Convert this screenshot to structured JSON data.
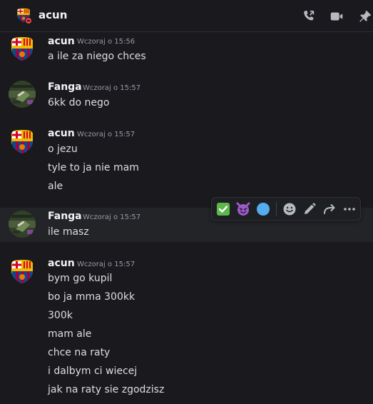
{
  "header": {
    "title": "acun",
    "icons": [
      "phone-call-icon",
      "video-camera-icon",
      "pin-icon"
    ]
  },
  "colors": {
    "background": "#1a1a1e",
    "hover_row": "#232428",
    "author": "#f2f3f5",
    "text": "#dbdee1",
    "timestamp": "#949ba4",
    "dnd_status": "#f23f43",
    "barca_blue": "#004d98",
    "barca_red": "#a50044",
    "barca_yellow": "#edbb00"
  },
  "messages": [
    {
      "author": "acun",
      "timestamp": "Wczoraj o 15:56",
      "lines": [
        "a ile za niego chces"
      ]
    },
    {
      "author": "Fanga",
      "timestamp": "Wczoraj o 15:57",
      "lines": [
        "6kk do nego"
      ]
    },
    {
      "author": "acun",
      "timestamp": "Wczoraj o 15:57",
      "lines": [
        "o jezu",
        "tyle to ja nie mam",
        "ale"
      ]
    },
    {
      "author": "Fanga",
      "timestamp": "Wczoraj o 15:57",
      "lines": [
        "ile masz"
      ]
    },
    {
      "author": "acun",
      "timestamp": "Wczoraj o 15:57",
      "lines": [
        "bym go kupil",
        "bo ja mma 300kk",
        "300k",
        "mam ale",
        "chce na raty",
        "i dalbym ci wiecej",
        "jak na raty sie zgodzisz"
      ]
    }
  ],
  "toolbar": {
    "actions": [
      "check-mark-reaction-icon",
      "smiling-imp-reaction-icon",
      "blue-circle-reaction-icon",
      "add-reaction-icon",
      "edit-pencil-icon",
      "forward-icon",
      "more-options-icon"
    ]
  }
}
